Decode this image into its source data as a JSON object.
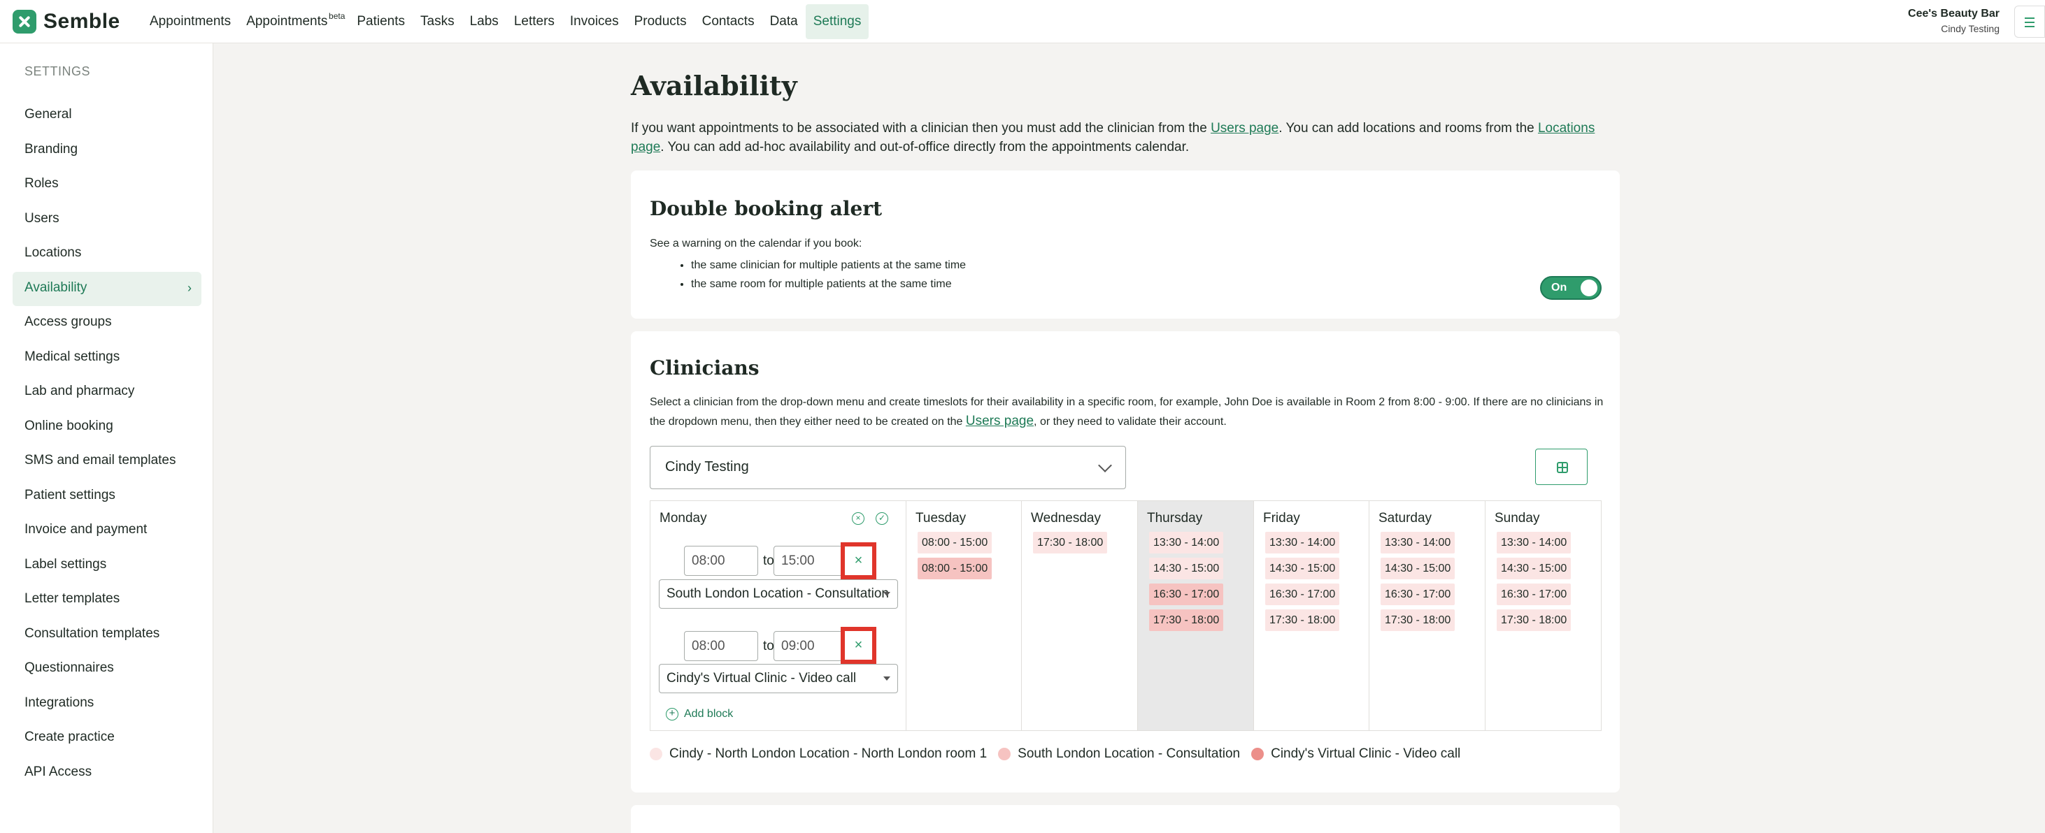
{
  "topbar": {
    "logo": "Semble",
    "nav": [
      {
        "label": "Appointments"
      },
      {
        "label": "Appointments",
        "badge": "beta"
      },
      {
        "label": "Patients"
      },
      {
        "label": "Tasks"
      },
      {
        "label": "Labs"
      },
      {
        "label": "Letters"
      },
      {
        "label": "Invoices"
      },
      {
        "label": "Products"
      },
      {
        "label": "Contacts"
      },
      {
        "label": "Data"
      },
      {
        "label": "Settings",
        "active": true
      }
    ],
    "account_name": "Cee's Beauty Bar",
    "account_user": "Cindy Testing"
  },
  "sidebar": {
    "heading": "SETTINGS",
    "items": [
      {
        "label": "General"
      },
      {
        "label": "Branding"
      },
      {
        "label": "Roles"
      },
      {
        "label": "Users"
      },
      {
        "label": "Locations"
      },
      {
        "label": "Availability",
        "active": true
      },
      {
        "label": "Access groups"
      },
      {
        "label": "Medical settings"
      },
      {
        "label": "Lab and pharmacy"
      },
      {
        "label": "Online booking"
      },
      {
        "label": "SMS and email templates"
      },
      {
        "label": "Patient settings"
      },
      {
        "label": "Invoice and payment"
      },
      {
        "label": "Label settings"
      },
      {
        "label": "Letter templates"
      },
      {
        "label": "Consultation templates"
      },
      {
        "label": "Questionnaires"
      },
      {
        "label": "Integrations"
      },
      {
        "label": "Create practice"
      },
      {
        "label": "API Access"
      }
    ]
  },
  "page": {
    "title": "Availability",
    "intro_1": "If you want appointments to be associated with a clinician then you must add the clinician from the ",
    "intro_link1": "Users page",
    "intro_2": ". You can add locations and rooms from the ",
    "intro_link2": "Locations page",
    "intro_3": ". You can add ad-hoc availability and out-of-office directly from the appointments calendar."
  },
  "double_booking": {
    "title": "Double booking alert",
    "desc": "See a warning on the calendar if you book:",
    "bullets": [
      "the same clinician for multiple patients at the same time",
      "the same room for multiple patients at the same time"
    ],
    "toggle_label": "On"
  },
  "clinicians": {
    "title": "Clinicians",
    "desc_1": "Select a clinician from the drop-down menu and create timeslots for their availability in a specific room, for example, John Doe is available in Room 2 from 8:00 - 9:00. If there are no clinicians in the dropdown menu, then they either need to be created on the ",
    "desc_link": "Users page",
    "desc_2": ", or they need to validate their account.",
    "selected_clinician": "Cindy Testing",
    "monday": {
      "name": "Monday",
      "blocks": [
        {
          "from": "08:00",
          "to_label": "to",
          "to": "15:00",
          "location": "South London Location - Consultation"
        },
        {
          "from": "08:00",
          "to_label": "to",
          "to": "09:00",
          "location": "Cindy's Virtual Clinic - Video call"
        }
      ],
      "add_block": "Add block"
    },
    "days": [
      {
        "name": "Tuesday",
        "slots": [
          {
            "t": "08:00 - 15:00",
            "c": "pink"
          },
          {
            "t": "08:00 - 15:00",
            "c": "red"
          }
        ]
      },
      {
        "name": "Wednesday",
        "slots": [
          {
            "t": "17:30 - 18:00",
            "c": "pink"
          }
        ]
      },
      {
        "name": "Thursday",
        "slots": [
          {
            "t": "13:30 - 14:00",
            "c": "pink"
          },
          {
            "t": "14:30 - 15:00",
            "c": "pink"
          },
          {
            "t": "16:30 - 17:00",
            "c": "red"
          },
          {
            "t": "17:30 - 18:00",
            "c": "red"
          }
        ]
      },
      {
        "name": "Friday",
        "slots": [
          {
            "t": "13:30 - 14:00",
            "c": "pink"
          },
          {
            "t": "14:30 - 15:00",
            "c": "pink"
          },
          {
            "t": "16:30 - 17:00",
            "c": "pink"
          },
          {
            "t": "17:30 - 18:00",
            "c": "pink"
          }
        ]
      },
      {
        "name": "Saturday",
        "slots": [
          {
            "t": "13:30 - 14:00",
            "c": "pink"
          },
          {
            "t": "14:30 - 15:00",
            "c": "pink"
          },
          {
            "t": "16:30 - 17:00",
            "c": "pink"
          },
          {
            "t": "17:30 - 18:00",
            "c": "pink"
          }
        ]
      },
      {
        "name": "Sunday",
        "slots": [
          {
            "t": "13:30 - 14:00",
            "c": "pink"
          },
          {
            "t": "14:30 - 15:00",
            "c": "pink"
          },
          {
            "t": "16:30 - 17:00",
            "c": "pink"
          },
          {
            "t": "17:30 - 18:00",
            "c": "pink"
          }
        ]
      }
    ],
    "legend": [
      {
        "label": "Cindy - North London Location - North London room 1",
        "color": "#fbe5e4"
      },
      {
        "label": "South London Location - Consultation",
        "color": "#f6c3c1"
      },
      {
        "label": "Cindy's Virtual Clinic - Video call",
        "color": "#ec8f8a"
      }
    ]
  },
  "colors": {
    "accent": "#2f9c6c",
    "accent_dark": "#1e7a56",
    "highlight": "#e0352b"
  }
}
